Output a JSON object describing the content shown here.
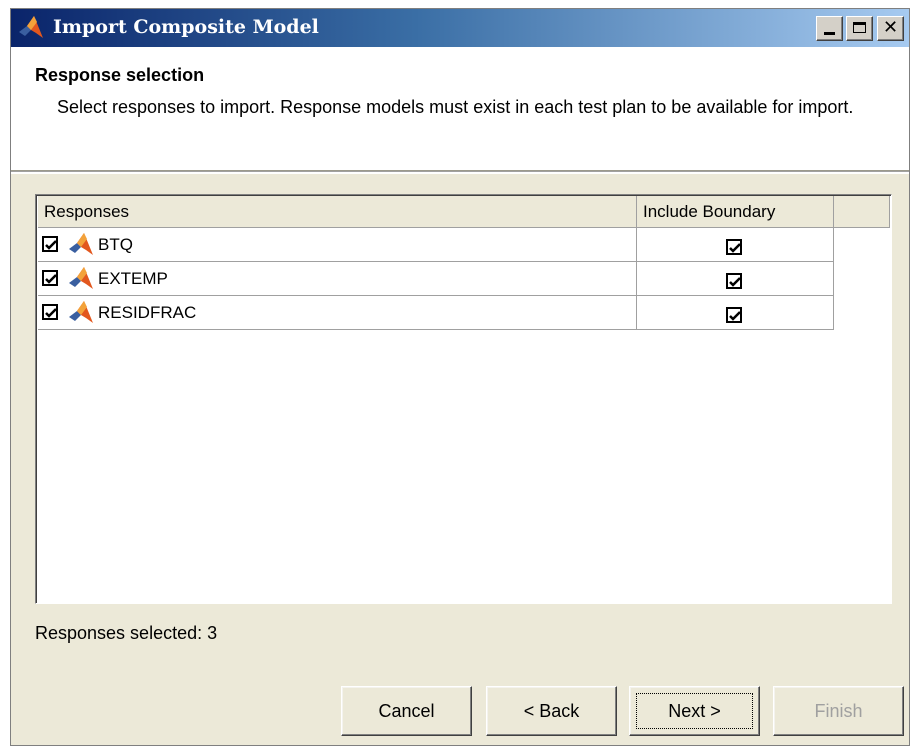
{
  "window": {
    "title": "Import Composite Model",
    "icon": "matlab-logo-icon"
  },
  "header": {
    "title": "Response selection",
    "description": "Select responses to import. Response models must exist in each test plan to be available for import."
  },
  "table": {
    "columns": [
      "Responses",
      "Include Boundary"
    ],
    "rows": [
      {
        "name": "BTQ",
        "selected": true,
        "include_boundary": true
      },
      {
        "name": "EXTEMP",
        "selected": true,
        "include_boundary": true
      },
      {
        "name": "RESIDFRAC",
        "selected": true,
        "include_boundary": true
      }
    ]
  },
  "status": "Responses selected: 3",
  "buttons": {
    "cancel": "Cancel",
    "back": "< Back",
    "next": "Next >",
    "finish": "Finish"
  },
  "colors": {
    "titlebar_start": "#0a246a",
    "titlebar_end": "#a6caf0",
    "dialog_bg": "#ece9d8",
    "disabled_text": "#a0a0a0"
  }
}
